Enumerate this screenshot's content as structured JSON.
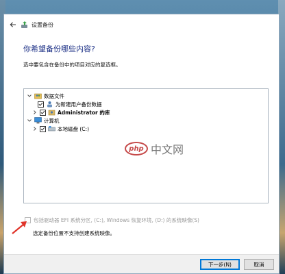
{
  "window": {
    "title": "设置备份"
  },
  "header": {
    "heading": "你希望备份哪些内容?",
    "instruction": "选中要包含在备份中的项目对应的复选框。"
  },
  "tree": {
    "items": [
      {
        "label": "数据文件",
        "checked": true,
        "expanded": true,
        "level": 0
      },
      {
        "label": "为新建用户备份数据",
        "checked": true,
        "level": 1
      },
      {
        "label": "Administrator 的库",
        "checked": true,
        "level": 1,
        "bold": true
      },
      {
        "label": "计算机",
        "checked": false,
        "expanded": true,
        "level": 0
      },
      {
        "label": "本地磁盘 (C:)",
        "checked": true,
        "level": 1
      }
    ]
  },
  "system_image": {
    "label": "包括驱动器 EFI 系统分区, (C:), Windows 恢复环境, (D:) 的系统映像(S)",
    "checked": false,
    "enabled": false,
    "note": "选定备份位置不支持创建系统映像。"
  },
  "footer": {
    "next_label": "下一步(N)",
    "cancel_label": "取消"
  },
  "watermark": {
    "badge": "php",
    "text": "中文网"
  },
  "colors": {
    "heading": "#1e3287",
    "accent": "#0078d7",
    "arrow": "#e0342a"
  }
}
